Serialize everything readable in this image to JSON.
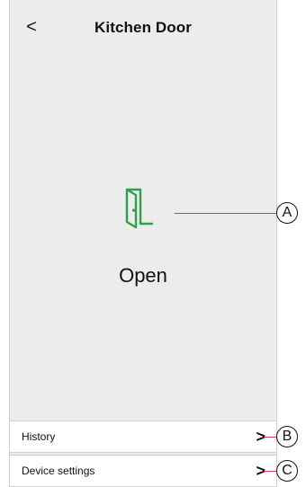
{
  "header": {
    "back_icon": "<",
    "title": "Kitchen Door"
  },
  "device": {
    "icon": "door-open-icon",
    "state": "Open",
    "icon_color": "#2e9e4f"
  },
  "menu": {
    "history_label": "History",
    "settings_label": "Device settings",
    "chevron": ">"
  },
  "callouts": {
    "a": "A",
    "b": "B",
    "c": "C",
    "line_color": "#d9365b"
  }
}
